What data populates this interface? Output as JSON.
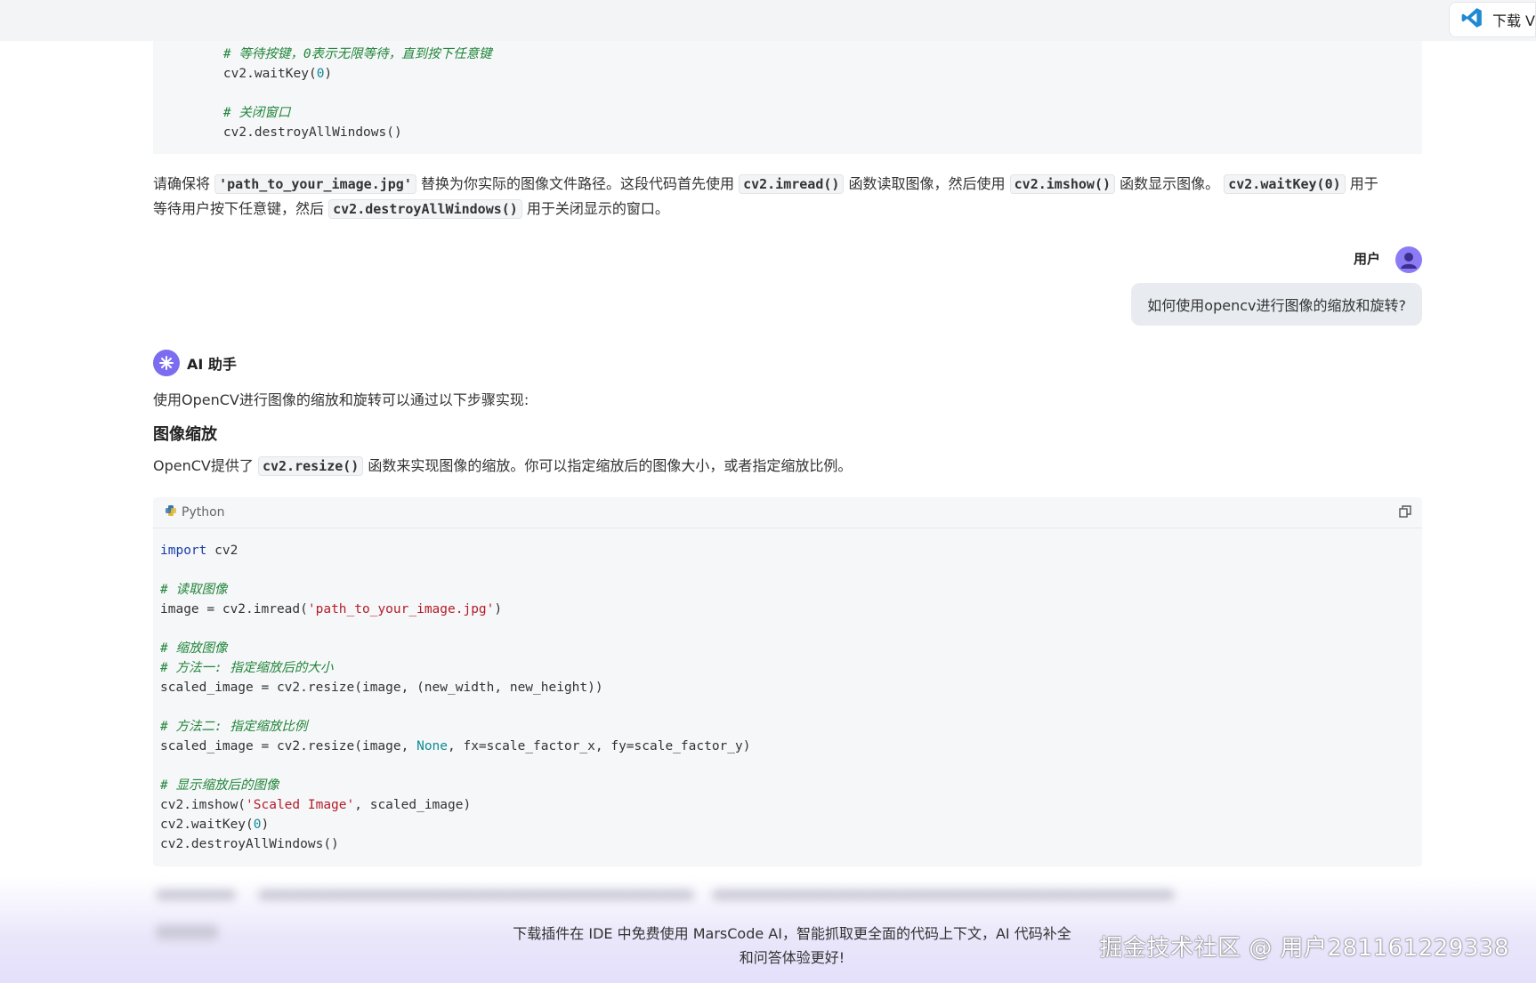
{
  "topbar": {
    "download_label": "下载 V"
  },
  "code_block_1": {
    "lines": [
      [
        {
          "t": "    ",
          "c": ""
        },
        {
          "t": "# 等待按键，0表示无限等待，直到按下任意键",
          "c": "cm"
        }
      ],
      [
        {
          "t": "    cv2.waitKey(",
          "c": ""
        },
        {
          "t": "0",
          "c": "nb"
        },
        {
          "t": ")",
          "c": ""
        }
      ],
      [
        {
          "t": "",
          "c": ""
        }
      ],
      [
        {
          "t": "    ",
          "c": ""
        },
        {
          "t": "# 关闭窗口",
          "c": "cm"
        }
      ],
      [
        {
          "t": "    cv2.destroyAllWindows()",
          "c": ""
        }
      ]
    ]
  },
  "explanation": {
    "p1": "请确保将",
    "c1": "'path_to_your_image.jpg'",
    "p2": "替换为你实际的图像文件路径。这段代码首先使用",
    "c2": "cv2.imread()",
    "p3": "函数读取图像，然后使用",
    "c3": "cv2.imshow()",
    "p4": "函数显示图像。",
    "c4": "cv2.waitKey(0)",
    "p5": "用于",
    "p6": "等待用户按下任意键，然后",
    "c5": "cv2.destroyAllWindows()",
    "p7": "用于关闭显示的窗口。"
  },
  "user": {
    "label": "用户",
    "message": "如何使用opencv进行图像的缩放和旋转?"
  },
  "assistant": {
    "label": "AI 助手",
    "intro": "使用OpenCV进行图像的缩放和旋转可以通过以下步骤实现:",
    "heading": "图像缩放",
    "resize_p1": "OpenCV提供了",
    "resize_code": "cv2.resize()",
    "resize_p2": "函数来实现图像的缩放。你可以指定缩放后的图像大小，或者指定缩放比例。"
  },
  "code_block_2": {
    "language": "Python",
    "lines": [
      [
        {
          "t": "import",
          "c": "kw"
        },
        {
          "t": " cv2",
          "c": ""
        }
      ],
      [
        {
          "t": "",
          "c": ""
        }
      ],
      [
        {
          "t": "# 读取图像",
          "c": "cm"
        }
      ],
      [
        {
          "t": "image = cv2.imread(",
          "c": ""
        },
        {
          "t": "'path_to_your_image.jpg'",
          "c": "st"
        },
        {
          "t": ")",
          "c": ""
        }
      ],
      [
        {
          "t": "",
          "c": ""
        }
      ],
      [
        {
          "t": "# 缩放图像",
          "c": "cm"
        }
      ],
      [
        {
          "t": "# 方法一: 指定缩放后的大小",
          "c": "cm"
        }
      ],
      [
        {
          "t": "scaled_image = cv2.resize(image, (new_width, new_height))",
          "c": ""
        }
      ],
      [
        {
          "t": "",
          "c": ""
        }
      ],
      [
        {
          "t": "# 方法二: 指定缩放比例",
          "c": "cm"
        }
      ],
      [
        {
          "t": "scaled_image = cv2.resize(image, ",
          "c": ""
        },
        {
          "t": "None",
          "c": "nb"
        },
        {
          "t": ", fx=scale_factor_x, fy=scale_factor_y)",
          "c": ""
        }
      ],
      [
        {
          "t": "",
          "c": ""
        }
      ],
      [
        {
          "t": "# 显示缩放后的图像",
          "c": "cm"
        }
      ],
      [
        {
          "t": "cv2.imshow(",
          "c": ""
        },
        {
          "t": "'Scaled Image'",
          "c": "st"
        },
        {
          "t": ", scaled_image)",
          "c": ""
        }
      ],
      [
        {
          "t": "cv2.waitKey(",
          "c": ""
        },
        {
          "t": "0",
          "c": "nb"
        },
        {
          "t": ")",
          "c": ""
        }
      ],
      [
        {
          "t": "cv2.destroyAllWindows()",
          "c": ""
        }
      ]
    ]
  },
  "promo": {
    "line1": "下载插件在 IDE 中免费使用 MarsCode AI，智能抓取更全面的代码上下文，AI 代码补全",
    "line2": "和问答体验更好!"
  },
  "watermark": "掘金技术社区 @ 用户281161229338",
  "colors": {
    "accent": "#7c6cf0",
    "code_bg": "#f6f7f9",
    "comment": "#22863a",
    "string": "#b31d28",
    "keyword": "#1a3ea8"
  }
}
